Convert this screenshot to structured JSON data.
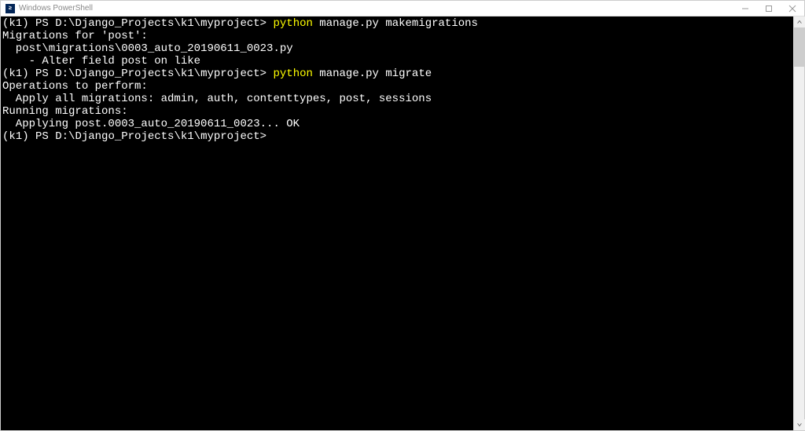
{
  "titlebar": {
    "title": "Windows PowerShell",
    "icon_char": "≥"
  },
  "terminal": {
    "lines": [
      {
        "prompt_env": "(k1) ",
        "prompt_ps": "PS ",
        "prompt_path": "D:\\Django_Projects\\k1\\myproject> ",
        "cmd_python": "python",
        "cmd_args": " manage.py makemigrations"
      },
      {
        "output": "Migrations for 'post':"
      },
      {
        "output": "  post\\migrations\\0003_auto_20190611_0023.py"
      },
      {
        "output": "    - Alter field post on like"
      },
      {
        "prompt_env": "(k1) ",
        "prompt_ps": "PS ",
        "prompt_path": "D:\\Django_Projects\\k1\\myproject> ",
        "cmd_python": "python",
        "cmd_args": " manage.py migrate"
      },
      {
        "output": "Operations to perform:"
      },
      {
        "output": "  Apply all migrations: admin, auth, contenttypes, post, sessions"
      },
      {
        "output": "Running migrations:"
      },
      {
        "output": "  Applying post.0003_auto_20190611_0023... OK"
      },
      {
        "prompt_env": "(k1) ",
        "prompt_ps": "PS ",
        "prompt_path": "D:\\Django_Projects\\k1\\myproject>",
        "cmd_python": "",
        "cmd_args": ""
      }
    ]
  }
}
